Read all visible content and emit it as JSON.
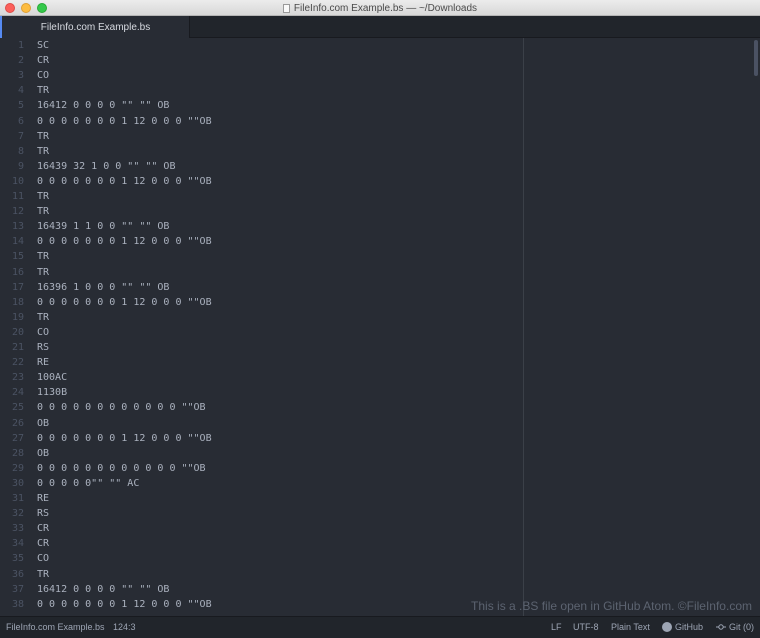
{
  "window": {
    "title": "FileInfo.com Example.bs — ~/Downloads"
  },
  "tabs": [
    {
      "label": "FileInfo.com Example.bs",
      "active": true
    }
  ],
  "editor": {
    "lines": [
      {
        "n": "1",
        "text": "SC"
      },
      {
        "n": "2",
        "text": "CR"
      },
      {
        "n": "3",
        "text": "CO"
      },
      {
        "n": "4",
        "text": "TR"
      },
      {
        "n": "5",
        "text": "16412 0 0 0 0 \"\" \"\" OB"
      },
      {
        "n": "6",
        "text": "0 0 0 0 0 0 0 1 12 0 0 0 \"\"OB"
      },
      {
        "n": "7",
        "text": "TR"
      },
      {
        "n": "8",
        "text": "TR"
      },
      {
        "n": "9",
        "text": "16439 32 1 0 0 \"\" \"\" OB"
      },
      {
        "n": "10",
        "text": "0 0 0 0 0 0 0 1 12 0 0 0 \"\"OB"
      },
      {
        "n": "11",
        "text": "TR"
      },
      {
        "n": "12",
        "text": "TR"
      },
      {
        "n": "13",
        "text": "16439 1 1 0 0 \"\" \"\" OB"
      },
      {
        "n": "14",
        "text": "0 0 0 0 0 0 0 1 12 0 0 0 \"\"OB"
      },
      {
        "n": "15",
        "text": "TR"
      },
      {
        "n": "16",
        "text": "TR"
      },
      {
        "n": "17",
        "text": "16396 1 0 0 0 \"\" \"\" OB"
      },
      {
        "n": "18",
        "text": "0 0 0 0 0 0 0 1 12 0 0 0 \"\"OB"
      },
      {
        "n": "19",
        "text": "TR"
      },
      {
        "n": "20",
        "text": "CO"
      },
      {
        "n": "21",
        "text": "RS"
      },
      {
        "n": "22",
        "text": "RE"
      },
      {
        "n": "23",
        "text": "100AC"
      },
      {
        "n": "24",
        "text": "1130B"
      },
      {
        "n": "25",
        "text": "0 0 0 0 0 0 0 0 0 0 0 0 \"\"OB"
      },
      {
        "n": "26",
        "text": "OB"
      },
      {
        "n": "27",
        "text": "0 0 0 0 0 0 0 1 12 0 0 0 \"\"OB"
      },
      {
        "n": "28",
        "text": "OB"
      },
      {
        "n": "29",
        "text": "0 0 0 0 0 0 0 0 0 0 0 0 \"\"OB"
      },
      {
        "n": "30",
        "text": "0 0 0 0 0\"\" \"\" AC"
      },
      {
        "n": "31",
        "text": "RE"
      },
      {
        "n": "32",
        "text": "RS"
      },
      {
        "n": "33",
        "text": "CR"
      },
      {
        "n": "34",
        "text": "CR"
      },
      {
        "n": "35",
        "text": "CO"
      },
      {
        "n": "36",
        "text": "TR"
      },
      {
        "n": "37",
        "text": "16412 0 0 0 0 \"\" \"\" OB"
      },
      {
        "n": "38",
        "text": "0 0 0 0 0 0 0 1 12 0 0 0 \"\"OB"
      }
    ],
    "watermark": "This is a .BS file open in GitHub Atom. ©FileInfo.com"
  },
  "statusbar": {
    "filename": "FileInfo.com Example.bs",
    "cursor": "124:3",
    "line_ending": "LF",
    "encoding": "UTF-8",
    "grammar": "Plain Text",
    "github": "GitHub",
    "git": "Git (0)"
  },
  "colors": {
    "editor_bg": "#282c34",
    "panel_bg": "#21252b",
    "text": "#abb2bf",
    "line_number": "#4b5363",
    "accent": "#568af2"
  },
  "icons": [
    "close-icon",
    "minimize-icon",
    "zoom-icon",
    "document-icon",
    "github-icon",
    "git-commit-icon"
  ]
}
